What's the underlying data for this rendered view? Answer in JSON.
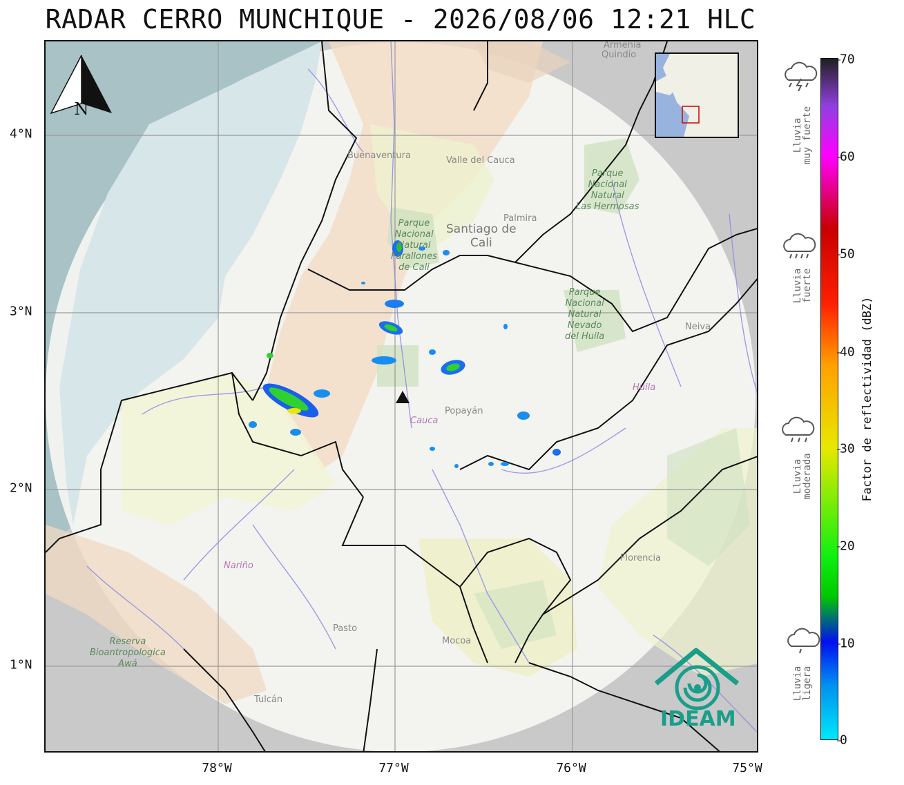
{
  "title": "RADAR CERRO MUNCHIQUE - 2026/08/06 12:21 HLC",
  "map": {
    "x_ticks": [
      "78°W",
      "77°W",
      "76°W",
      "75°W"
    ],
    "y_ticks": [
      "4°N",
      "3°N",
      "2°N",
      "1°N"
    ],
    "north_label": "N",
    "radar_marker": "radar-site",
    "places": {
      "buenaventura": "Buenaventura",
      "valle": "Valle del Cauca",
      "quindio": "Quindío",
      "armenia": "Armenia",
      "palmira": "Palmira",
      "cali_1": "Santiago de",
      "cali_2": "Cali",
      "farallones_1": "Parque",
      "farallones_2": "Nacional",
      "farallones_3": "Natural",
      "farallones_4": "Farallones",
      "farallones_5": "de Cali",
      "hermosas_1": "Parque",
      "hermosas_2": "Nacional",
      "hermosas_3": "Natural",
      "hermosas_4": "Las Hermosas",
      "nevado_1": "Parque",
      "nevado_2": "Nacional",
      "nevado_3": "Natural",
      "nevado_4": "Nevado",
      "nevado_5": "del Huila",
      "neiva": "Neiva",
      "huila": "Huila",
      "popayan": "Popayán",
      "cauca": "Cauca",
      "narino": "Nariño",
      "pasto": "Pasto",
      "mocoa": "Mocoa",
      "florencia": "Florencia",
      "tulcan": "Tulcán",
      "awa_1": "Reserva",
      "awa_2": "Bioantropologica",
      "awa_3": "Awá"
    }
  },
  "legend": {
    "label": "Factor de reflectividad (dBZ)",
    "ticks": [
      "70",
      "60",
      "50",
      "40",
      "30",
      "20",
      "10",
      "0"
    ],
    "categories": [
      {
        "line1": "Lluvia",
        "line2": "muy fuerte",
        "icon": "storm-cloud-icon"
      },
      {
        "line1": "Lluvia",
        "line2": "fuerte",
        "icon": "heavy-rain-cloud-icon"
      },
      {
        "line1": "Lluvia",
        "line2": "moderada",
        "icon": "moderate-rain-cloud-icon"
      },
      {
        "line1": "Lluvia",
        "line2": "ligera",
        "icon": "light-rain-cloud-icon"
      }
    ]
  },
  "logo": {
    "text": "IDEAM"
  },
  "colors": {
    "ocean": "#a9c7d6",
    "radar_coverage": "#f6f6f4",
    "logo": "#1a9e8a"
  }
}
